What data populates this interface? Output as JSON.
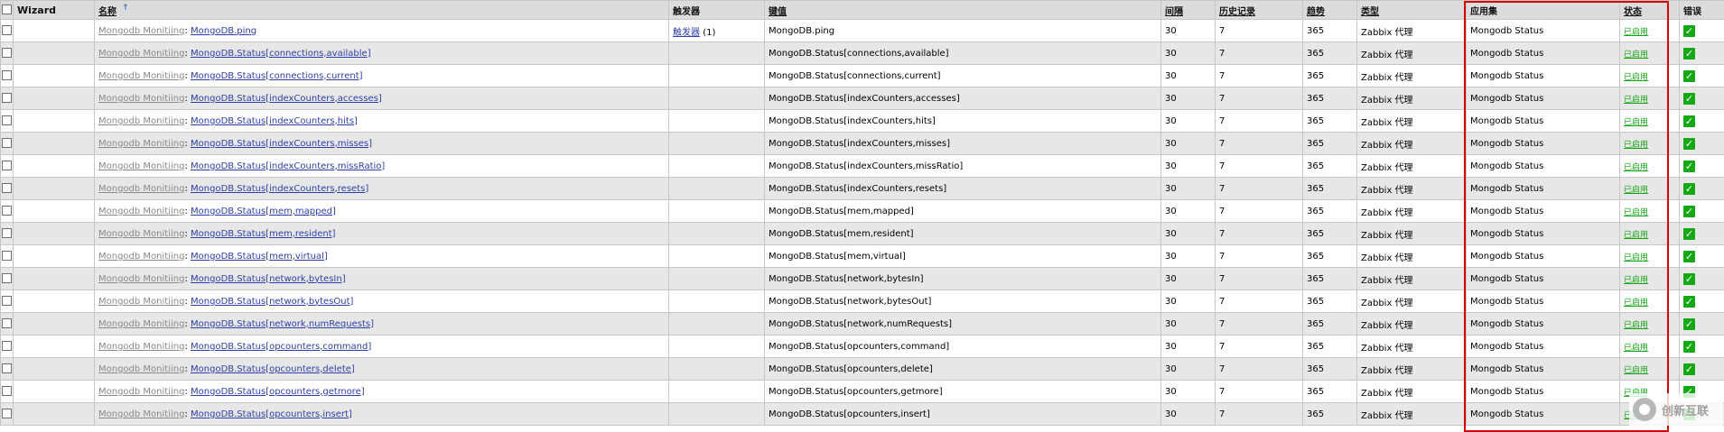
{
  "header": {
    "wizard": "Wizard",
    "name": "名称",
    "name_sort_arrow": "↑",
    "triggers": "触发器",
    "key": "键值",
    "interval": "间隔",
    "history": "历史记录",
    "trends": "趋势",
    "type": "类型",
    "applications": "应用集",
    "status": "状态",
    "errors": "错误"
  },
  "rows": [
    {
      "template": "Mongodb Monitiing",
      "name": "MongoDB.ping",
      "triggers": "触发器",
      "trigger_count": "(1)",
      "key": "MongoDB.ping",
      "interval": "30",
      "history": "7",
      "trends": "365",
      "type": "Zabbix 代理",
      "application": "Mongodb Status",
      "status": "已启用",
      "error": "✓"
    },
    {
      "template": "Mongodb Monitiing",
      "name": "MongoDB.Status[connections,available]",
      "triggers": "",
      "trigger_count": "",
      "key": "MongoDB.Status[connections,available]",
      "interval": "30",
      "history": "7",
      "trends": "365",
      "type": "Zabbix 代理",
      "application": "Mongodb Status",
      "status": "已启用",
      "error": "✓"
    },
    {
      "template": "Mongodb Monitiing",
      "name": "MongoDB.Status[connections,current]",
      "triggers": "",
      "trigger_count": "",
      "key": "MongoDB.Status[connections,current]",
      "interval": "30",
      "history": "7",
      "trends": "365",
      "type": "Zabbix 代理",
      "application": "Mongodb Status",
      "status": "已启用",
      "error": "✓"
    },
    {
      "template": "Mongodb Monitiing",
      "name": "MongoDB.Status[indexCounters,accesses]",
      "triggers": "",
      "trigger_count": "",
      "key": "MongoDB.Status[indexCounters,accesses]",
      "interval": "30",
      "history": "7",
      "trends": "365",
      "type": "Zabbix 代理",
      "application": "Mongodb Status",
      "status": "已启用",
      "error": "✓"
    },
    {
      "template": "Mongodb Monitiing",
      "name": "MongoDB.Status[indexCounters,hits]",
      "triggers": "",
      "trigger_count": "",
      "key": "MongoDB.Status[indexCounters,hits]",
      "interval": "30",
      "history": "7",
      "trends": "365",
      "type": "Zabbix 代理",
      "application": "Mongodb Status",
      "status": "已启用",
      "error": "✓"
    },
    {
      "template": "Mongodb Monitiing",
      "name": "MongoDB.Status[indexCounters,misses]",
      "triggers": "",
      "trigger_count": "",
      "key": "MongoDB.Status[indexCounters,misses]",
      "interval": "30",
      "history": "7",
      "trends": "365",
      "type": "Zabbix 代理",
      "application": "Mongodb Status",
      "status": "已启用",
      "error": "✓"
    },
    {
      "template": "Mongodb Monitiing",
      "name": "MongoDB.Status[indexCounters,missRatio]",
      "triggers": "",
      "trigger_count": "",
      "key": "MongoDB.Status[indexCounters,missRatio]",
      "interval": "30",
      "history": "7",
      "trends": "365",
      "type": "Zabbix 代理",
      "application": "Mongodb Status",
      "status": "已启用",
      "error": "✓"
    },
    {
      "template": "Mongodb Monitiing",
      "name": "MongoDB.Status[indexCounters,resets]",
      "triggers": "",
      "trigger_count": "",
      "key": "MongoDB.Status[indexCounters,resets]",
      "interval": "30",
      "history": "7",
      "trends": "365",
      "type": "Zabbix 代理",
      "application": "Mongodb Status",
      "status": "已启用",
      "error": "✓"
    },
    {
      "template": "Mongodb Monitiing",
      "name": "MongoDB.Status[mem,mapped]",
      "triggers": "",
      "trigger_count": "",
      "key": "MongoDB.Status[mem,mapped]",
      "interval": "30",
      "history": "7",
      "trends": "365",
      "type": "Zabbix 代理",
      "application": "Mongodb Status",
      "status": "已启用",
      "error": "✓"
    },
    {
      "template": "Mongodb Monitiing",
      "name": "MongoDB.Status[mem,resident]",
      "triggers": "",
      "trigger_count": "",
      "key": "MongoDB.Status[mem,resident]",
      "interval": "30",
      "history": "7",
      "trends": "365",
      "type": "Zabbix 代理",
      "application": "Mongodb Status",
      "status": "已启用",
      "error": "✓"
    },
    {
      "template": "Mongodb Monitiing",
      "name": "MongoDB.Status[mem,virtual]",
      "triggers": "",
      "trigger_count": "",
      "key": "MongoDB.Status[mem,virtual]",
      "interval": "30",
      "history": "7",
      "trends": "365",
      "type": "Zabbix 代理",
      "application": "Mongodb Status",
      "status": "已启用",
      "error": "✓"
    },
    {
      "template": "Mongodb Monitiing",
      "name": "MongoDB.Status[network,bytesIn]",
      "triggers": "",
      "trigger_count": "",
      "key": "MongoDB.Status[network,bytesIn]",
      "interval": "30",
      "history": "7",
      "trends": "365",
      "type": "Zabbix 代理",
      "application": "Mongodb Status",
      "status": "已启用",
      "error": "✓"
    },
    {
      "template": "Mongodb Monitiing",
      "name": "MongoDB.Status[network,bytesOut]",
      "triggers": "",
      "trigger_count": "",
      "key": "MongoDB.Status[network,bytesOut]",
      "interval": "30",
      "history": "7",
      "trends": "365",
      "type": "Zabbix 代理",
      "application": "Mongodb Status",
      "status": "已启用",
      "error": "✓"
    },
    {
      "template": "Mongodb Monitiing",
      "name": "MongoDB.Status[network,numRequests]",
      "triggers": "",
      "trigger_count": "",
      "key": "MongoDB.Status[network,numRequests]",
      "interval": "30",
      "history": "7",
      "trends": "365",
      "type": "Zabbix 代理",
      "application": "Mongodb Status",
      "status": "已启用",
      "error": "✓"
    },
    {
      "template": "Mongodb Monitiing",
      "name": "MongoDB.Status[opcounters,command]",
      "triggers": "",
      "trigger_count": "",
      "key": "MongoDB.Status[opcounters,command]",
      "interval": "30",
      "history": "7",
      "trends": "365",
      "type": "Zabbix 代理",
      "application": "Mongodb Status",
      "status": "已启用",
      "error": "✓"
    },
    {
      "template": "Mongodb Monitiing",
      "name": "MongoDB.Status[opcounters,delete]",
      "triggers": "",
      "trigger_count": "",
      "key": "MongoDB.Status[opcounters,delete]",
      "interval": "30",
      "history": "7",
      "trends": "365",
      "type": "Zabbix 代理",
      "application": "Mongodb Status",
      "status": "已启用",
      "error": "✓"
    },
    {
      "template": "Mongodb Monitiing",
      "name": "MongoDB.Status[opcounters,getmore]",
      "triggers": "",
      "trigger_count": "",
      "key": "MongoDB.Status[opcounters,getmore]",
      "interval": "30",
      "history": "7",
      "trends": "365",
      "type": "Zabbix 代理",
      "application": "Mongodb Status",
      "status": "已启用",
      "error": "✓"
    },
    {
      "template": "Mongodb Monitiing",
      "name": "MongoDB.Status[opcounters,insert]",
      "triggers": "",
      "trigger_count": "",
      "key": "MongoDB.Status[opcounters,insert]",
      "interval": "30",
      "history": "7",
      "trends": "365",
      "type": "Zabbix 代理",
      "application": "Mongodb Status",
      "status": "已启用",
      "error": "✓"
    }
  ],
  "watermark": {
    "text": "创新互联"
  },
  "colors": {
    "highlight_box": "#d40000",
    "status_enabled": "#13a313",
    "link": "#2d3fa8",
    "template_link": "#8a8a8a"
  }
}
